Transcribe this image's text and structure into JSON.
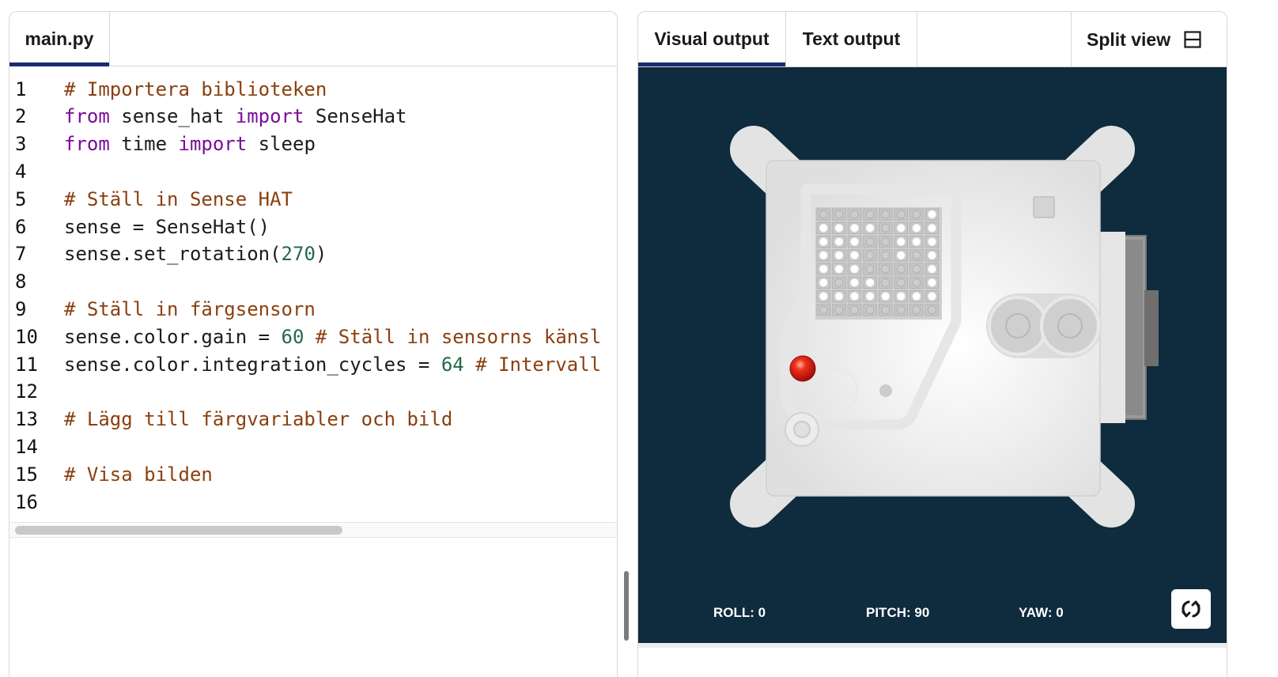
{
  "editor": {
    "file_tab": "main.py",
    "lines": [
      {
        "n": "1",
        "tokens": [
          {
            "t": "# Importera biblioteken",
            "c": "cm"
          }
        ]
      },
      {
        "n": "2",
        "tokens": [
          {
            "t": "from",
            "c": "kw"
          },
          {
            "t": " sense_hat ",
            "c": ""
          },
          {
            "t": "import",
            "c": "kw"
          },
          {
            "t": " SenseHat",
            "c": ""
          }
        ]
      },
      {
        "n": "3",
        "tokens": [
          {
            "t": "from",
            "c": "kw"
          },
          {
            "t": " time ",
            "c": ""
          },
          {
            "t": "import",
            "c": "kw"
          },
          {
            "t": " sleep",
            "c": ""
          }
        ]
      },
      {
        "n": "4",
        "tokens": []
      },
      {
        "n": "5",
        "tokens": [
          {
            "t": "# Ställ in Sense HAT",
            "c": "cm"
          }
        ]
      },
      {
        "n": "6",
        "tokens": [
          {
            "t": "sense = SenseHat()",
            "c": ""
          }
        ]
      },
      {
        "n": "7",
        "tokens": [
          {
            "t": "sense.set_rotation(",
            "c": ""
          },
          {
            "t": "270",
            "c": "num"
          },
          {
            "t": ")",
            "c": ""
          }
        ]
      },
      {
        "n": "8",
        "tokens": []
      },
      {
        "n": "9",
        "tokens": [
          {
            "t": "# Ställ in färgsensorn",
            "c": "cm"
          }
        ]
      },
      {
        "n": "10",
        "tokens": [
          {
            "t": "sense.color.gain = ",
            "c": ""
          },
          {
            "t": "60",
            "c": "num"
          },
          {
            "t": " ",
            "c": ""
          },
          {
            "t": "# Ställ in sensorns känsl",
            "c": "cm"
          }
        ]
      },
      {
        "n": "11",
        "tokens": [
          {
            "t": "sense.color.integration_cycles = ",
            "c": ""
          },
          {
            "t": "64",
            "c": "num"
          },
          {
            "t": " ",
            "c": ""
          },
          {
            "t": "# Intervall",
            "c": "cm"
          }
        ]
      },
      {
        "n": "12",
        "tokens": []
      },
      {
        "n": "13",
        "tokens": [
          {
            "t": "# Lägg till färgvariabler och bild",
            "c": "cm"
          }
        ]
      },
      {
        "n": "14",
        "tokens": []
      },
      {
        "n": "15",
        "tokens": [
          {
            "t": "# Visa bilden",
            "c": "cm"
          }
        ]
      },
      {
        "n": "16",
        "tokens": []
      }
    ]
  },
  "output": {
    "tabs": {
      "visual": "Visual output",
      "text": "Text output"
    },
    "split_view": "Split view",
    "readouts": {
      "roll": "ROLL: 0",
      "pitch": "PITCH: 90",
      "yaw": "YAW: 0"
    },
    "led_matrix": [
      "00000001",
      "11110111",
      "11100111",
      "11100101",
      "11100001",
      "10110001",
      "11111111",
      "00000000"
    ]
  },
  "colors": {
    "accent": "#1b2a74",
    "stage_bg": "#0f2b3e",
    "comment": "#8b3f0f",
    "keyword": "#7a0d99",
    "number": "#23694a"
  },
  "icons": {
    "split": "split-view-icon",
    "reset": "reset-orientation-icon"
  }
}
